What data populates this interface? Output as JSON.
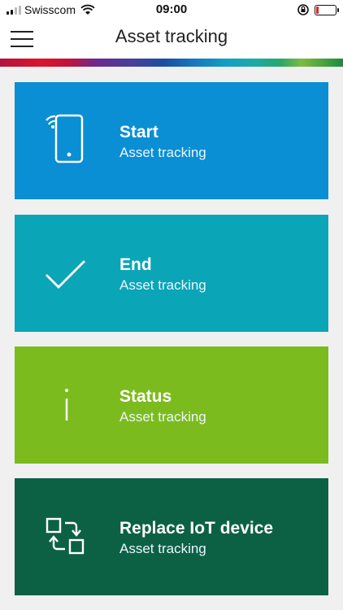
{
  "statusbar": {
    "carrier": "Swisscom",
    "time": "09:00"
  },
  "header": {
    "title": "Asset tracking"
  },
  "cards": [
    {
      "title": "Start",
      "subtitle": "Asset tracking",
      "color": "#0a8ed4",
      "icon": "smartphone-wireless-icon"
    },
    {
      "title": "End",
      "subtitle": "Asset tracking",
      "color": "#0aa5b7",
      "icon": "checkmark-icon"
    },
    {
      "title": "Status",
      "subtitle": "Asset tracking",
      "color": "#7cbb1e",
      "icon": "info-icon"
    },
    {
      "title": "Replace IoT device",
      "subtitle": "Asset tracking",
      "color": "#0c6145",
      "icon": "replace-swap-icon"
    }
  ]
}
